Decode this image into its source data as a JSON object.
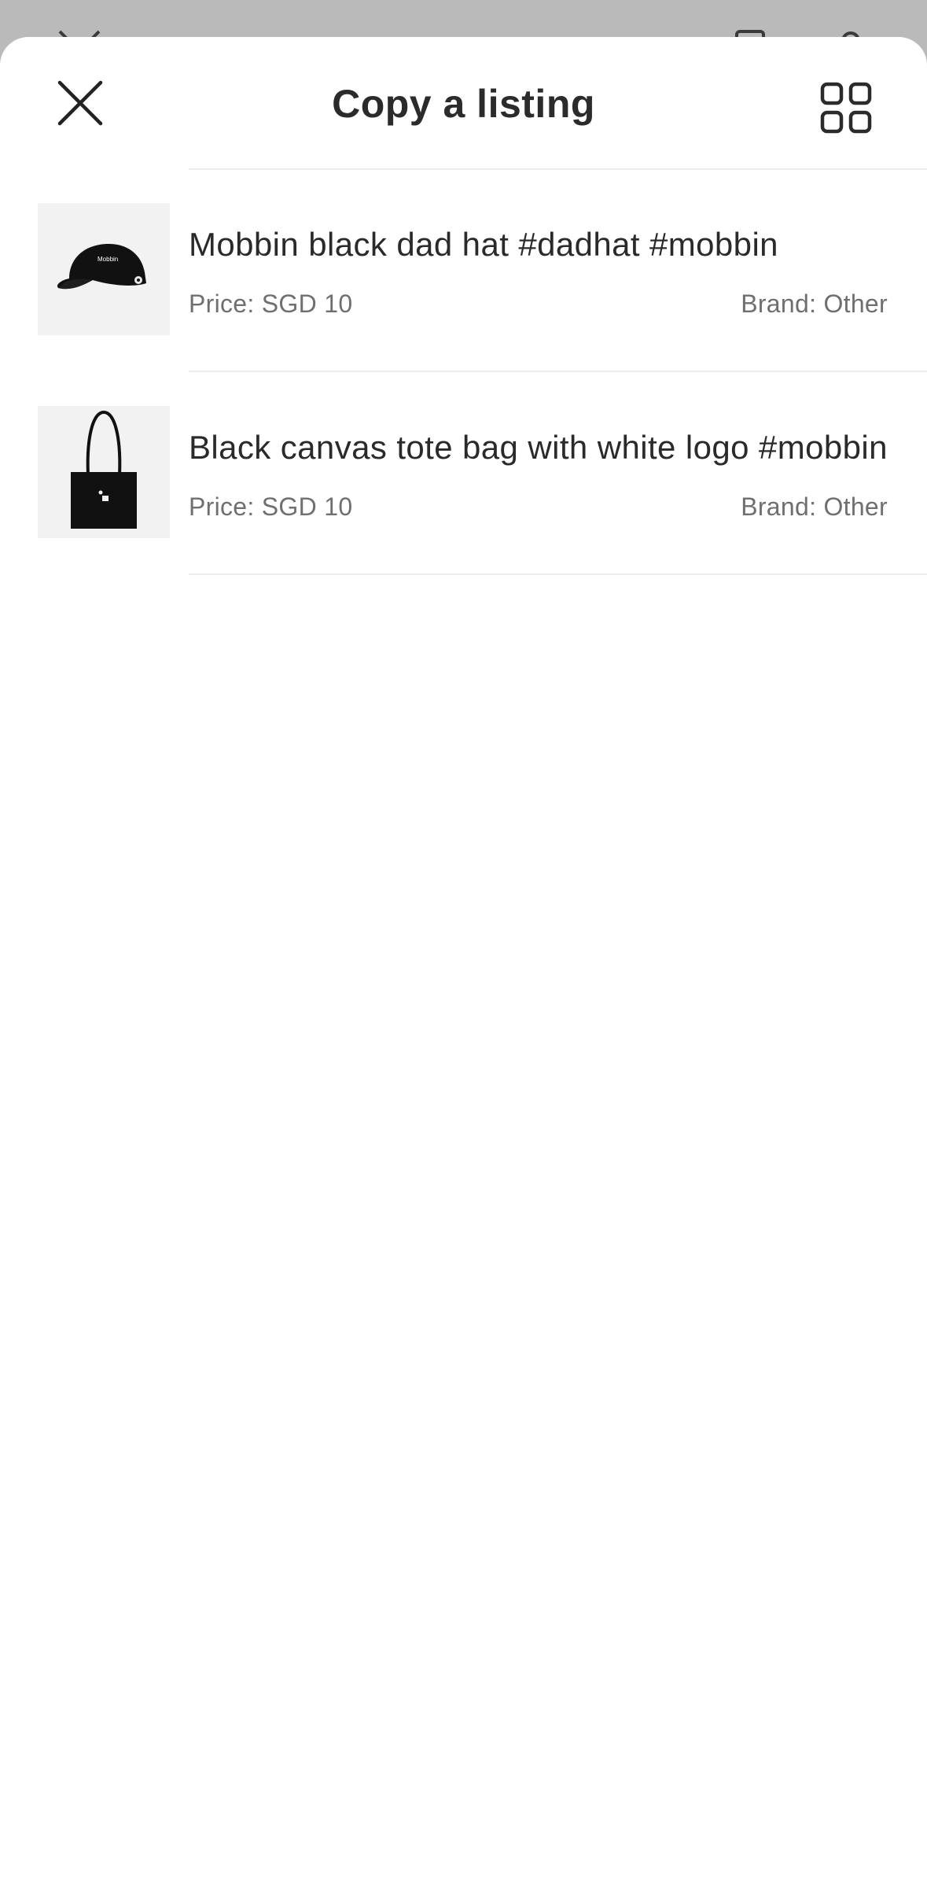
{
  "header": {
    "title": "Copy a listing",
    "close_icon": "close-icon",
    "view_toggle_icon": "grid-view-icon"
  },
  "listings": [
    {
      "name": "Mobbin black dad hat #dadhat #mobbin",
      "price": "Price: SGD 10",
      "brand": "Brand: Other",
      "thumbnail_icon": "black-cap-image",
      "thumbnail_text": "Mobbin"
    },
    {
      "name": "Black canvas tote bag with white logo #mobbin",
      "price": "Price: SGD 10",
      "brand": "Brand: Other",
      "thumbnail_icon": "black-tote-bag-image"
    }
  ],
  "colors": {
    "backdrop": "#b9bab9",
    "sheet": "#ffffff",
    "title_text": "#2b2b2b",
    "secondary_text": "#6f6f6f",
    "divider": "#ececec",
    "thumb_bg": "#f2f2f2"
  }
}
